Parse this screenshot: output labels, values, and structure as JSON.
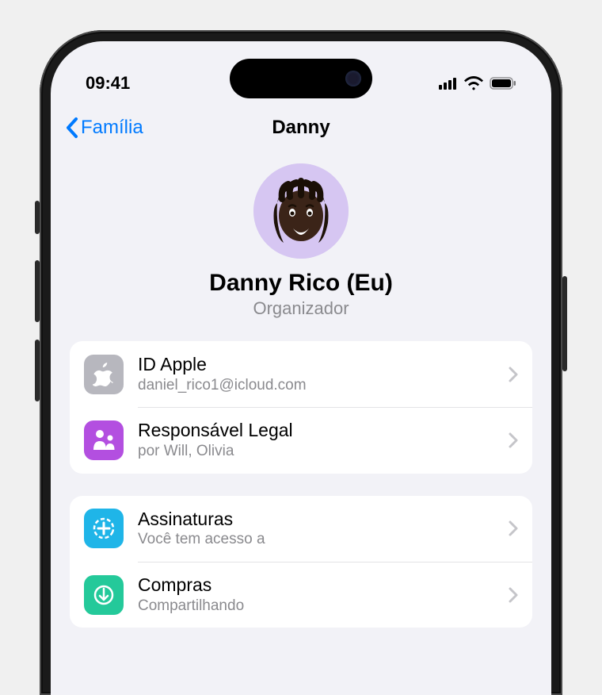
{
  "status": {
    "time": "09:41"
  },
  "nav": {
    "back_label": "Família",
    "title": "Danny"
  },
  "profile": {
    "name": "Danny Rico (Eu)",
    "role": "Organizador"
  },
  "group1": {
    "items": [
      {
        "icon": "apple-icon",
        "icon_bg": "#b7b7be",
        "title": "ID Apple",
        "sub": "daniel_rico1@icloud.com"
      },
      {
        "icon": "guardian-icon",
        "icon_bg": "#b34fe0",
        "title": "Responsável Legal",
        "sub": "por Will, Olivia"
      }
    ]
  },
  "group2": {
    "items": [
      {
        "icon": "subscriptions-icon",
        "icon_bg": "#1fb5e8",
        "title": "Assinaturas",
        "sub": "Você tem acesso a"
      },
      {
        "icon": "purchases-icon",
        "icon_bg": "#24c99a",
        "title": "Compras",
        "sub": "Compartilhando"
      }
    ]
  }
}
